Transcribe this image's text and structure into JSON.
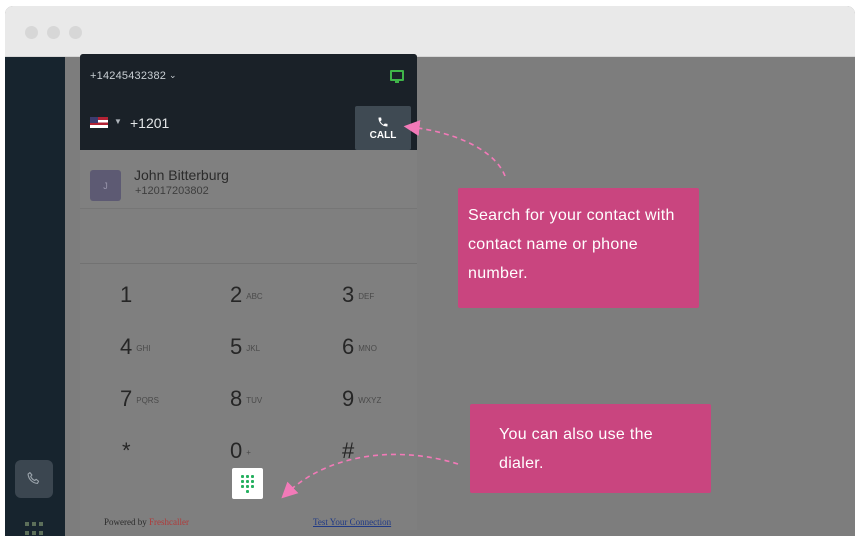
{
  "window": {
    "controls": [
      "close",
      "minimize",
      "maximize"
    ]
  },
  "sidebar": {
    "phone_icon": "phone-icon",
    "apps_icon": "grid-icon"
  },
  "widget": {
    "from_number": "+14245432382",
    "from_caret": "⌄",
    "country": "US",
    "dial_value": "+1201",
    "call_label": "CALL",
    "contact": {
      "initial": "J",
      "name": "John Bitterburg",
      "number": "+12017203802"
    },
    "keypad": [
      {
        "digit": "1",
        "letters": ""
      },
      {
        "digit": "2",
        "letters": "ABC"
      },
      {
        "digit": "3",
        "letters": "DEF"
      },
      {
        "digit": "4",
        "letters": "GHI"
      },
      {
        "digit": "5",
        "letters": "JKL"
      },
      {
        "digit": "6",
        "letters": "MNO"
      },
      {
        "digit": "7",
        "letters": "PQRS"
      },
      {
        "digit": "8",
        "letters": "TUV"
      },
      {
        "digit": "9",
        "letters": "WXYZ"
      },
      {
        "digit": "*",
        "letters": ""
      },
      {
        "digit": "0",
        "letters": "+"
      },
      {
        "digit": "#",
        "letters": ""
      }
    ],
    "footer": {
      "powered_by": "Powered by",
      "brand": "Freshcaller",
      "test_link": "Test Your Connection"
    }
  },
  "tooltips": {
    "search_tip": "Search for your contact with contact name or phone number.",
    "dialer_tip": "You can also use the dialer."
  },
  "colors": {
    "accent_tooltip": "#c9457f",
    "dark_header": "#1a2128",
    "status_green": "#3fb449",
    "arrow_pink": "#f27ab8"
  }
}
